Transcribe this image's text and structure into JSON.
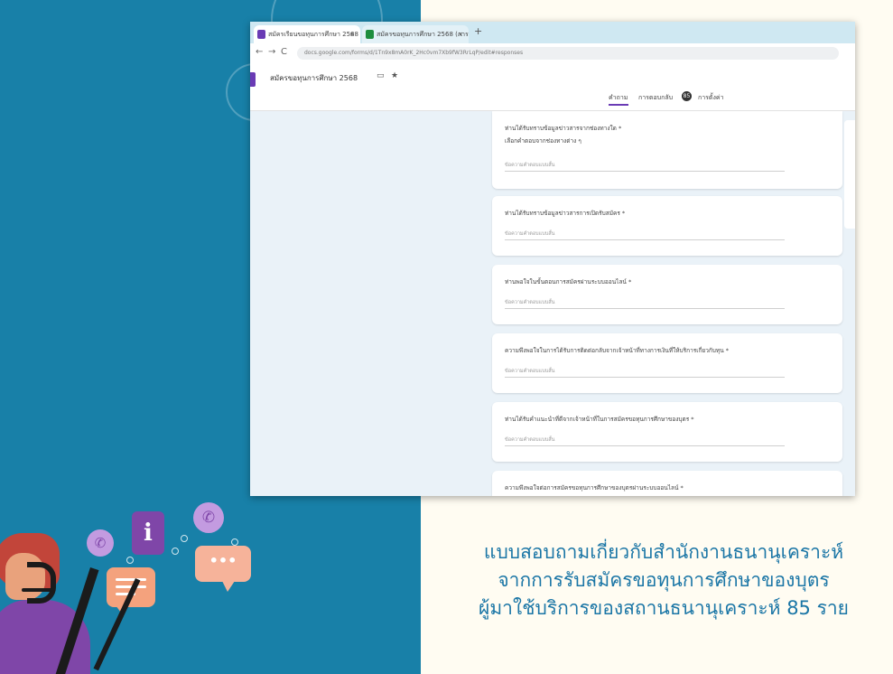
{
  "browser": {
    "tabs": [
      {
        "label": "สมัครเรียนขอทุนการศึกษา 2568 - G",
        "close": "×",
        "active": true
      },
      {
        "label": "สมัครขอทุนการศึกษา 2568 (การ",
        "close": "×",
        "active": false
      }
    ],
    "new_tab": "+",
    "url": "docs.google.com/forms/d/1Tn9x8mA0rK_2Hc0vm7Xb9fW3RrLqP/edit#responses",
    "nav": {
      "back": "←",
      "forward": "→",
      "reload": "C"
    }
  },
  "form": {
    "title": "สมัครขอทุนการศึกษา 2568",
    "tabs": {
      "questions": "คำถาม",
      "responses": "การตอบกลับ",
      "response_count": "85",
      "settings": "การตั้งค่า"
    },
    "questions": [
      {
        "text": "ท่านได้รับทราบข้อมูลข่าวสารจากช่องทางใด *",
        "sub": "เลือกคำตอบจากช่องทางต่าง ๆ",
        "answer_placeholder": "ข้อความคำตอบแบบสั้น"
      },
      {
        "text": "ท่านได้รับทราบข้อมูลข่าวสารการเปิดรับสมัคร *",
        "sub": "",
        "answer_placeholder": "ข้อความคำตอบแบบสั้น"
      },
      {
        "text": "ท่านพอใจในขั้นตอนการสมัครผ่านระบบออนไลน์ *",
        "sub": "",
        "answer_placeholder": "ข้อความคำตอบแบบสั้น"
      },
      {
        "text": "ความพึงพอใจในการได้รับการติดต่อกลับจากเจ้าหน้าที่ทางการเงินที่ให้บริการเกี่ยวกับทุน *",
        "sub": "",
        "answer_placeholder": "ข้อความคำตอบแบบสั้น"
      },
      {
        "text": "ท่านได้รับคำแนะนำที่ดีจากเจ้าหน้าที่ในการสมัครขอทุนการศึกษาของบุตร *",
        "sub": "",
        "answer_placeholder": "ข้อความคำตอบแบบสั้น"
      },
      {
        "text": "ความพึงพอใจต่อการสมัครขอทุนการศึกษาของบุตรผ่านระบบออนไลน์ *",
        "sub": "",
        "answer_placeholder": ""
      }
    ]
  },
  "caption": {
    "line1": "แบบสอบถามเกี่ยวกับสำนักงานธนานุเคราะห์",
    "line2": "จากการรับสมัครขอทุนการศึกษาของบุตร",
    "line3_prefix": "ผู้มาใช้บริการของสถานธนานุเคราะห์ ",
    "line3_number": "85",
    "line3_suffix": " ราย"
  },
  "illustration": {
    "info_symbol": "i",
    "bubble_dots": "•••",
    "phone_symbol": "✆"
  },
  "colors": {
    "left_bg": "#1880a8",
    "right_bg": "#fffcf2",
    "caption_text": "#1b76a6",
    "forms_purple": "#6a3bb5"
  }
}
